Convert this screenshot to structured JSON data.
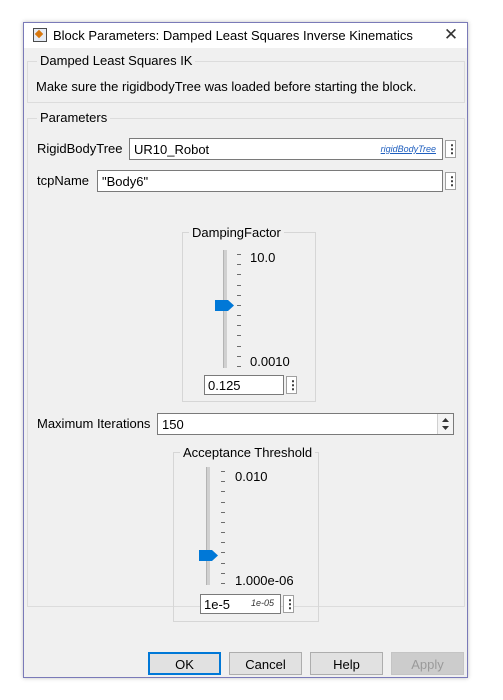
{
  "window": {
    "title": "Block Parameters: Damped Least Squares Inverse Kinematics",
    "close": "✕"
  },
  "description": {
    "group_title": "Damped Least Squares IK",
    "text": "Make sure the rigidbodyTree was loaded before starting the block."
  },
  "parameters": {
    "group_title": "Parameters",
    "rigid_body_tree": {
      "label": "RigidBodyTree",
      "value": "UR10_Robot",
      "type_link": "rigidBodyTree"
    },
    "tcp_name": {
      "label": "tcpName",
      "value": "\"Body6\""
    },
    "damping_factor": {
      "title": "DampingFactor",
      "max_label": "10.0",
      "min_label": "0.0010",
      "value": "0.125",
      "level": 0.53
    },
    "max_iterations": {
      "label": "Maximum Iterations",
      "value": "150"
    },
    "acceptance_threshold": {
      "title": "Acceptance Threshold",
      "max_label": "0.010",
      "min_label": "1.000e-06",
      "value": "1e-5",
      "hint": "1e-05",
      "level": 0.25
    }
  },
  "buttons": {
    "ok": "OK",
    "cancel": "Cancel",
    "help": "Help",
    "apply": "Apply"
  },
  "colors": {
    "accent": "#0078d7"
  }
}
